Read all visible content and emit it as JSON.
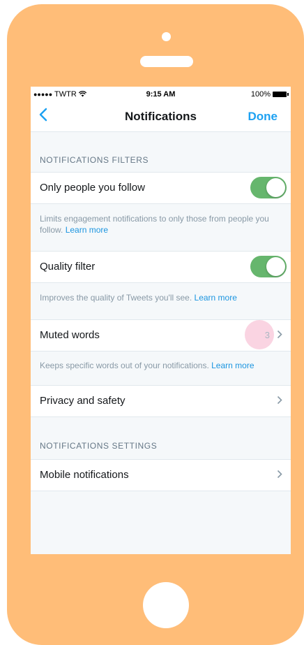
{
  "statusbar": {
    "carrier": "TWTR",
    "time": "9:15 AM",
    "battery": "100%"
  },
  "navbar": {
    "title": "Notifications",
    "done_label": "Done"
  },
  "filters": {
    "header": "NOTIFICATIONS FILTERS",
    "only_people": {
      "label": "Only people you follow",
      "enabled": true,
      "desc": "Limits engagement notifications to only those from people you follow. ",
      "link": "Learn more"
    },
    "quality": {
      "label": "Quality filter",
      "enabled": true,
      "desc": "Improves the quality of Tweets you'll see. ",
      "link": "Learn more"
    },
    "muted": {
      "label": "Muted words",
      "count": "3",
      "desc": "Keeps specific words out of your notifications. ",
      "link": "Learn more"
    },
    "privacy": {
      "label": "Privacy and safety"
    }
  },
  "settings": {
    "header": "NOTIFICATIONS SETTINGS",
    "mobile": {
      "label": "Mobile notifications"
    }
  },
  "colors": {
    "phone_body": "#ffbd78",
    "accent": "#1da1f2",
    "toggle_on": "#66b66d"
  }
}
